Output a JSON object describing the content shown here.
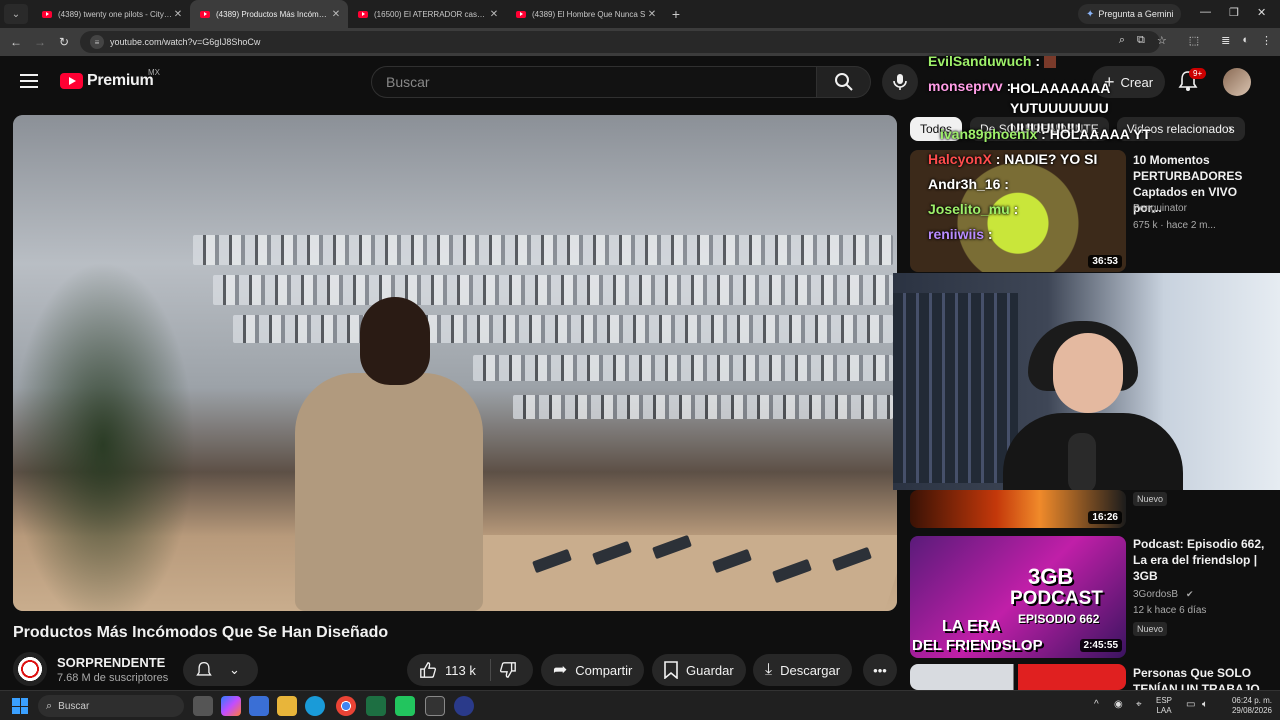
{
  "browser": {
    "tabs": [
      {
        "title": "(4389) twenty one pilots - City W",
        "active": false
      },
      {
        "title": "(4389) Productos Más Incómodos",
        "active": true
      },
      {
        "title": "(16500) El ATERRADOR caso de",
        "active": false
      },
      {
        "title": "(4389) El Hombre Que Nunca S",
        "active": false
      }
    ],
    "gemini_label": "Pregunta a Gemini",
    "url": "youtube.com/watch?v=G6gIJ8ShoCw"
  },
  "masthead": {
    "brand": "Premium",
    "country": "MX",
    "search_placeholder": "Buscar",
    "create_label": "Crear",
    "notif_badge": "9+"
  },
  "video": {
    "title": "Productos Más Incómodos Que Se Han Diseñado",
    "channel": "SORPRENDENTE",
    "subscribers": "7.68 M de suscriptores",
    "likes": "113 k",
    "share": "Compartir",
    "save": "Guardar",
    "download": "Descargar"
  },
  "chips": [
    "Todos",
    "De SORPRENDENTE",
    "Videos relacionados"
  ],
  "recommendations": [
    {
      "title": "10 Momentos PERTURBADORES Captados en VIVO por...",
      "channel": "Penguinator",
      "meta": "675 k · hace 2 m...",
      "duration": "36:53"
    },
    {
      "title": "",
      "channel": "",
      "meta": "",
      "duration": "16:26",
      "badge": "Nuevo"
    },
    {
      "title": "Podcast: Episodio 662, La era del friendslop | 3GB",
      "channel": "3GordosB",
      "meta": "12 k  hace 6 días",
      "duration": "2:45:55",
      "badge": "Nuevo",
      "thumb_text_1": "3GB",
      "thumb_text_2": "PODCAST",
      "thumb_text_3": "EPISODIO 662",
      "thumb_text_4": "LA ERA",
      "thumb_text_5": "DEL FRIENDSLOP"
    },
    {
      "title": "Personas Que SOLO TENÍAN UN TRABAJO",
      "duration": ""
    }
  ],
  "chat": [
    {
      "user": "EvilSanduwuch",
      "msg": "",
      "color": "#9ef06a"
    },
    {
      "user": "monseprvv",
      "msg": "HOLAAAAAAA YUTUUUUUUUUUUUUUU",
      "color": "#ff9de6"
    },
    {
      "user": "ivan89phoenix",
      "msg": "HOLAAAAA YT",
      "color": "#9ef06a"
    },
    {
      "user": "HalcyonX",
      "msg": "NADIE? YO SI",
      "color": "#ff4d4d"
    },
    {
      "user": "Andr3h_16",
      "msg": "",
      "color": "#ffffff"
    },
    {
      "user": "Joselito_mu",
      "msg": "",
      "color": "#9ef06a"
    },
    {
      "user": "reniiwiis",
      "msg": "",
      "color": "#b98cff"
    }
  ],
  "taskbar": {
    "search": "Buscar",
    "lang_1": "ESP",
    "lang_2": "LAA",
    "time": "06:24 p. m.",
    "date": "29/08/2026"
  }
}
